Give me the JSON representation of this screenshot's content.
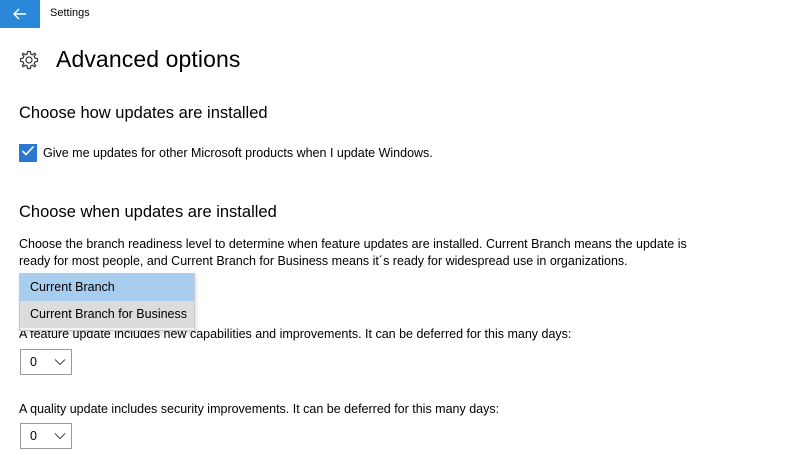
{
  "window": {
    "app_title": "Settings",
    "back_icon": "arrow-left-icon",
    "accent_color": "#2b88d8"
  },
  "header": {
    "icon": "gear-icon",
    "title": "Advanced options"
  },
  "install_section": {
    "heading": "Choose how updates are installed",
    "checkbox": {
      "checked": true,
      "label": "Give me updates for other Microsoft products when I update Windows."
    }
  },
  "when_section": {
    "heading": "Choose when updates are installed",
    "description": "Choose the branch readiness level to determine when feature updates are installed. Current Branch means the update is ready for most people, and Current Branch for Business means it´s ready for widespread use in organizations.",
    "branch_dropdown": {
      "options": [
        "Current Branch",
        "Current Branch for Business"
      ],
      "selected_index": 0,
      "hovered_index": 1
    },
    "feature_text": "A feature update includes new capabilities and improvements. It can be deferred for this many days:",
    "feature_days": "0",
    "quality_text": "A quality update includes security improvements. It can be deferred for this many days:",
    "quality_days": "0"
  }
}
